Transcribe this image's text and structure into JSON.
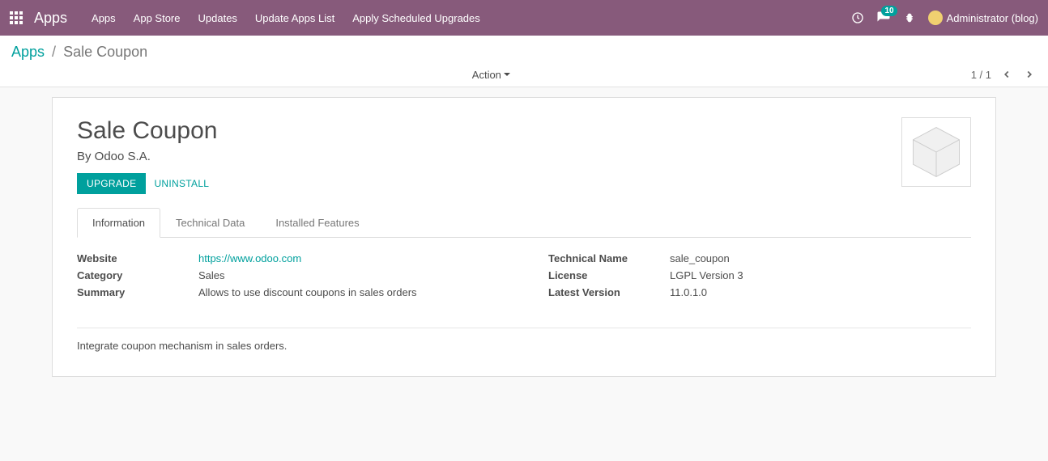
{
  "navbar": {
    "title": "Apps",
    "menu": [
      "Apps",
      "App Store",
      "Updates",
      "Update Apps List",
      "Apply Scheduled Upgrades"
    ],
    "messages_badge": "10",
    "user_label": "Administrator (blog)"
  },
  "breadcrumb": {
    "root": "Apps",
    "current": "Sale Coupon"
  },
  "control": {
    "action_label": "Action",
    "pager": "1 / 1"
  },
  "module": {
    "title": "Sale Coupon",
    "author_line": "By Odoo S.A.",
    "upgrade_btn": "Upgrade",
    "uninstall_btn": "Uninstall",
    "tabs": [
      "Information",
      "Technical Data",
      "Installed Features"
    ],
    "fields_left": {
      "website_label": "Website",
      "website_value": "https://www.odoo.com",
      "category_label": "Category",
      "category_value": "Sales",
      "summary_label": "Summary",
      "summary_value": "Allows to use discount coupons in sales orders"
    },
    "fields_right": {
      "tech_name_label": "Technical Name",
      "tech_name_value": "sale_coupon",
      "license_label": "License",
      "license_value": "LGPL Version 3",
      "version_label": "Latest Version",
      "version_value": "11.0.1.0"
    },
    "description": "Integrate coupon mechanism in sales orders."
  }
}
